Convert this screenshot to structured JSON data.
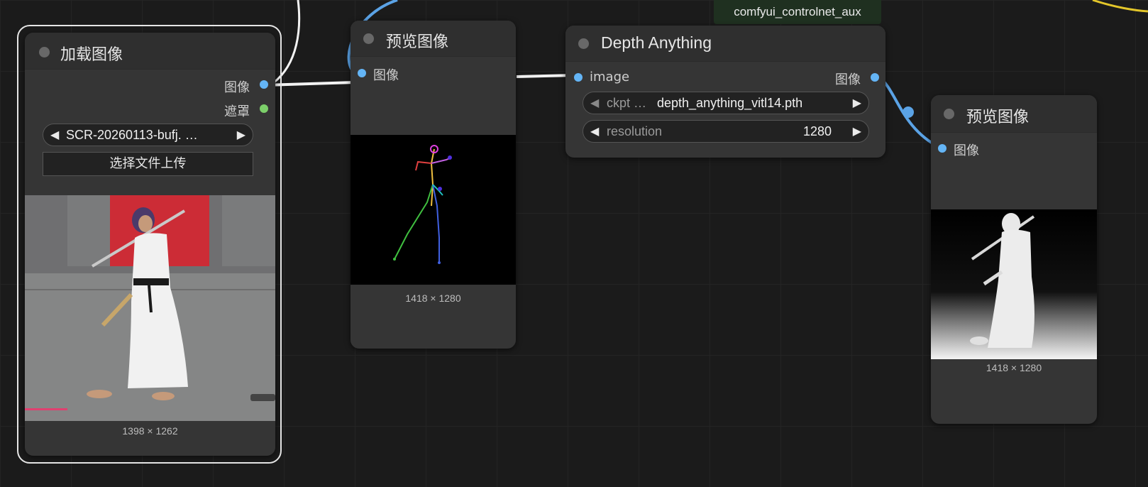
{
  "badge": "comfyui_controlnet_aux",
  "load_node": {
    "title": "加载图像",
    "output_image": "图像",
    "output_mask": "遮罩",
    "file_value": "SCR-20260113-bufj. …",
    "upload_button": "选择文件上传",
    "size": "1398 × 1262"
  },
  "preview1": {
    "title": "预览图像",
    "input_image": "图像",
    "size": "1418 × 1280"
  },
  "depth_node": {
    "title": "Depth Anything",
    "input_image": "image",
    "output_image": "图像",
    "ckpt_label": "ckpt …",
    "ckpt_value": "depth_anything_vitl14.pth",
    "resolution_label": "resolution",
    "resolution_value": "1280"
  },
  "preview2": {
    "title": "预览图像",
    "input_image": "图像",
    "size": "1418 × 1280"
  },
  "colors": {
    "canvas": "#1b1b1b",
    "node_body": "#353535",
    "image_slot": "#64b5f6",
    "mask_slot": "#7ccf6a",
    "badge_bg": "#1f3020"
  }
}
